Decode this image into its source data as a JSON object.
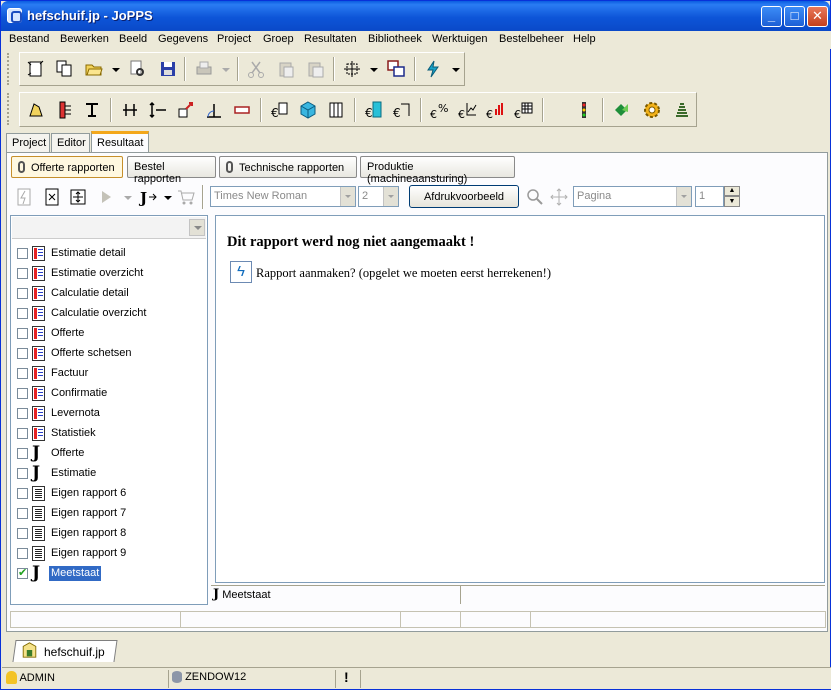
{
  "window": {
    "title": "hefschuif.jp - JoPPS"
  },
  "menu": [
    "Bestand",
    "Bewerken",
    "Beeld",
    "Gegevens",
    "Project",
    "Groep",
    "Resultaten",
    "Bibliotheek",
    "Werktuigen",
    "Bestelbeheer",
    "Help"
  ],
  "toolbar1_icons": [
    "new-icon",
    "copy-doc-icon",
    "open-folder-icon",
    "find-icon",
    "save-icon",
    "print-icon",
    "cut-icon",
    "paste-icon",
    "paste-special-icon",
    "grid-select-icon",
    "windows-icon",
    "lightning-icon"
  ],
  "toolbar2_icons": [
    "profile-icon",
    "hinge-icon",
    "t-profile-icon",
    "dimension-icon",
    "arrows-icon",
    "move-icon",
    "angle-icon",
    "panel-icon",
    "euro-box-icon",
    "cube-icon",
    "hardware-icon",
    "door-icon",
    "frame-icon",
    "percent-icon",
    "chart-line-icon",
    "bar-chart-icon",
    "table-icon",
    "traffic-light-icon",
    "recycle-icon",
    "gear-icon",
    "stack-icon"
  ],
  "outer_tabs": [
    "Project",
    "Editor",
    "Resultaat"
  ],
  "active_outer_tab": "Resultaat",
  "report_tabs": [
    "Offerte rapporten",
    "Bestel rapporten",
    "Technische rapporten",
    "Produktie (machineaansturing)"
  ],
  "active_report_tab": "Offerte rapporten",
  "sub_toolbar": {
    "font": "Times New Roman",
    "size": "2",
    "preview_button": "Afdrukvoorbeeld",
    "page_combo": "Pagina",
    "page_number": "1"
  },
  "reports": [
    {
      "label": "Estimatie detail",
      "icon": "rep",
      "checked": false
    },
    {
      "label": "Estimatie overzicht",
      "icon": "rep",
      "checked": false
    },
    {
      "label": "Calculatie detail",
      "icon": "rep",
      "checked": false
    },
    {
      "label": "Calculatie overzicht",
      "icon": "rep",
      "checked": false
    },
    {
      "label": "Offerte",
      "icon": "rep",
      "checked": false
    },
    {
      "label": "Offerte schetsen",
      "icon": "rep",
      "checked": false
    },
    {
      "label": "Factuur",
      "icon": "rep",
      "checked": false
    },
    {
      "label": "Confirmatie",
      "icon": "rep",
      "checked": false
    },
    {
      "label": "Levernota",
      "icon": "rep",
      "checked": false
    },
    {
      "label": "Statistiek",
      "icon": "rep",
      "checked": false
    },
    {
      "label": "Offerte",
      "icon": "j",
      "checked": false
    },
    {
      "label": "Estimatie",
      "icon": "j",
      "checked": false
    },
    {
      "label": "Eigen rapport 6",
      "icon": "list",
      "checked": false
    },
    {
      "label": "Eigen rapport 7",
      "icon": "list",
      "checked": false
    },
    {
      "label": "Eigen rapport 8",
      "icon": "list",
      "checked": false
    },
    {
      "label": "Eigen rapport 9",
      "icon": "list",
      "checked": false
    },
    {
      "label": "Meetstaat",
      "icon": "j",
      "checked": true,
      "selected": true
    }
  ],
  "content": {
    "heading": "Dit rapport werd nog niet aangemaakt !",
    "action_text": "Rapport aanmaken? (opgelet we moeten eerst herrekenen!)"
  },
  "panel_status": {
    "report_name": "Meetstaat"
  },
  "document_tab": "hefschuif.jp",
  "statusbar": {
    "user": "ADMIN",
    "database": "ZENDOW12",
    "alert": "!"
  },
  "colors": {
    "titlebar": "#0a5be0",
    "selection": "#316ac5",
    "tab_highlight": "#f3a71b"
  }
}
